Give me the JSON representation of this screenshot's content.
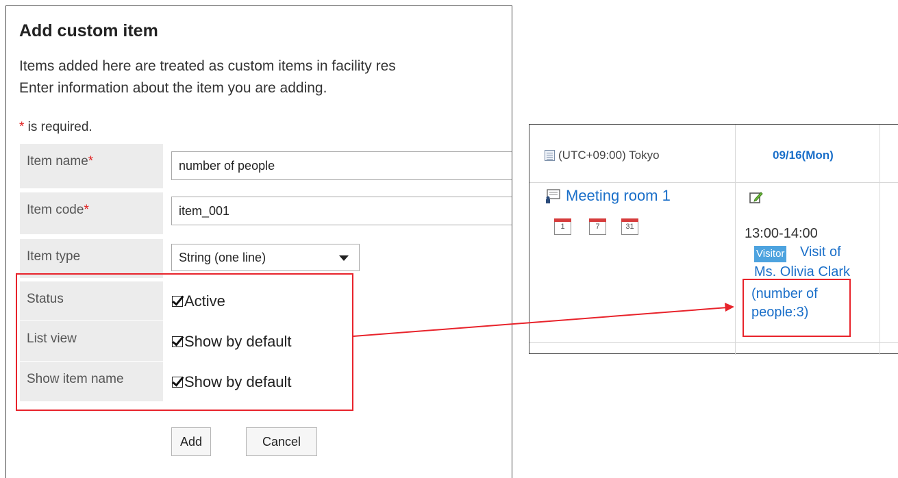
{
  "form": {
    "title": "Add custom item",
    "description_line1": "Items added here are treated as custom items in facility res",
    "description_line2": "Enter information about the item you are adding.",
    "required_star": "*",
    "required_note": " is required.",
    "fields": {
      "item_name_label": "Item name",
      "item_name_value": "number of people",
      "item_code_label": "Item code",
      "item_code_value": "item_001",
      "item_type_label": "Item type",
      "item_type_value": "String (one line)",
      "status_label": "Status",
      "status_option": "Active",
      "list_view_label": "List view",
      "list_view_option": "Show by default",
      "show_item_name_label": "Show item name",
      "show_item_name_option": "Show by default"
    },
    "buttons": {
      "add": "Add",
      "cancel": "Cancel"
    }
  },
  "calendar": {
    "timezone": "(UTC+09:00) Tokyo",
    "date": "09/16(Mon)",
    "room": "Meeting room 1",
    "cal_icons": [
      "1",
      "7",
      "31"
    ],
    "event": {
      "time": "13:00-14:00",
      "badge": "Visitor",
      "title_line1": "Visit of",
      "title_line2": "Ms. Olivia Clark",
      "custom_line1": "(number of",
      "custom_line2": "people:3)"
    }
  },
  "colors": {
    "highlight": "#e8232b",
    "link": "#1a6fc9",
    "badge": "#4da3df",
    "label_bg": "#ececec"
  }
}
